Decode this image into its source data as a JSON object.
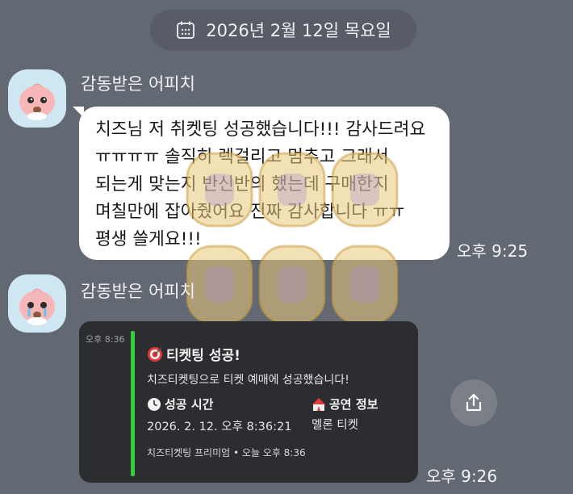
{
  "date_divider": {
    "text": "2026년 2월 12일 목요일",
    "icon": "calendar-icon"
  },
  "messages": [
    {
      "sender": "감동받은 어피치",
      "text": "치즈님 저 취켓팅 성공했습니다!!! 감사드려요 ㅠㅠㅠㅠ 솔직히 렉걸리고 멈추고 그래서 되는게 맞는지 반신반의 했는데 구매한지 며칠만에 잡아줬어요 진짜 감사합니다 ㅠㅠ 평생 쓸게요!!!",
      "time": "오후 9:25"
    },
    {
      "sender": "감동받은 어피치",
      "time": "오후 9:26",
      "card": {
        "stamp": "오후 8:36",
        "title": "티켓팅 성공!",
        "title_icon": "target-icon",
        "description": "치즈티켓팅으로 티켓 예매에 성공했습니다!",
        "field1_label": "성공 시간",
        "field1_icon": "clock-icon",
        "field1_value": "2026. 2. 12. 오후 8:36:21",
        "field2_label": "공연 정보",
        "field2_icon": "circus-tent-icon",
        "field2_value": "멜론 티켓",
        "footer": "치즈티켓팅 프리미엄 • 오늘 오후 8:36"
      }
    }
  ],
  "share_button": {
    "icon": "share-icon"
  },
  "colors": {
    "background": "#636973",
    "accent_bar": "#34d03c",
    "bubble": "#ffffff"
  }
}
